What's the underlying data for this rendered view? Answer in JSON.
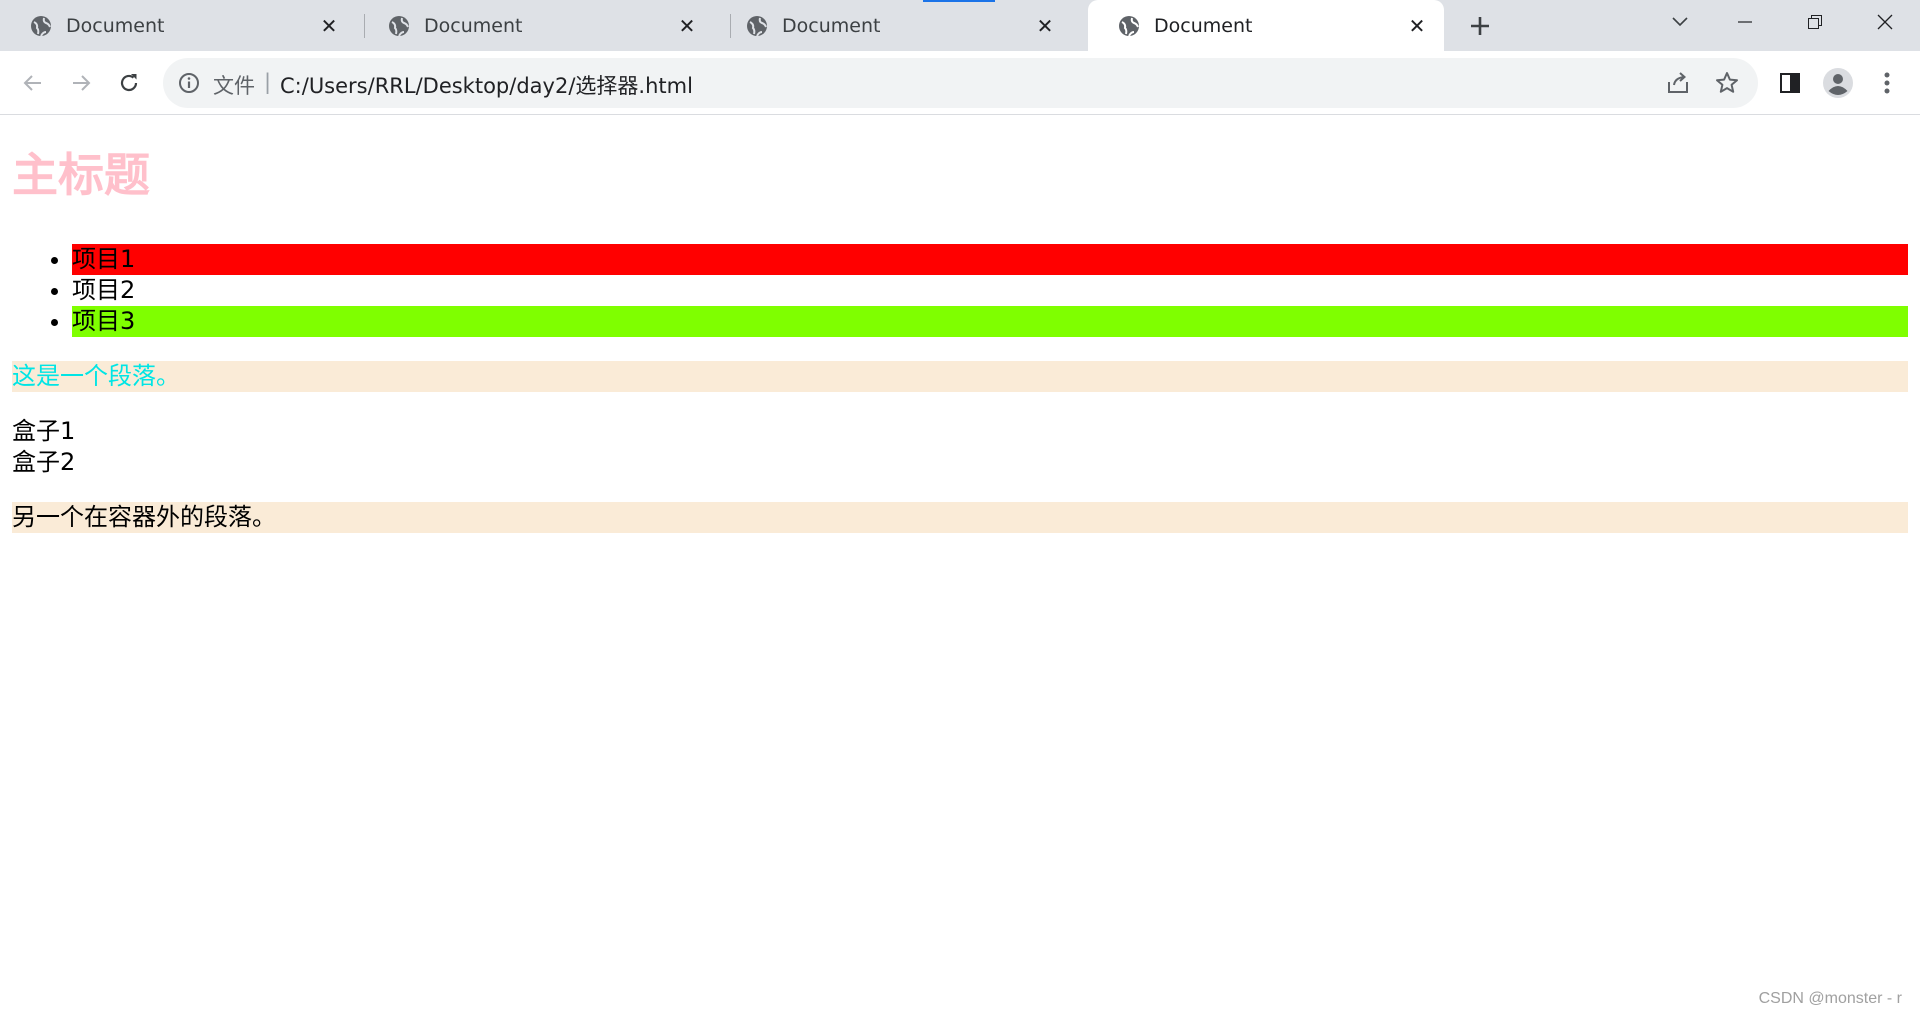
{
  "browser": {
    "tabs": [
      {
        "title": "Document",
        "active": false
      },
      {
        "title": "Document",
        "active": false
      },
      {
        "title": "Document",
        "active": false
      },
      {
        "title": "Document",
        "active": true
      }
    ],
    "address": {
      "scheme_label": "文件",
      "divider": "|",
      "url": "C:/Users/RRL/Desktop/day2/选择器.html"
    },
    "icons": {
      "tab_favicon": "globe-icon",
      "tab_close": "close-icon",
      "new_tab": "plus-icon",
      "back": "arrow-left-icon",
      "forward": "arrow-right-icon",
      "reload": "reload-icon",
      "site_info": "info-icon",
      "share": "share-icon",
      "bookmark": "star-icon",
      "side_panel": "side-panel-icon",
      "profile": "profile-icon",
      "menu": "more-vert-icon"
    }
  },
  "page": {
    "heading": "主标题",
    "list_items": [
      "项目1",
      "项目2",
      "项目3"
    ],
    "paragraph_1": "这是一个段落。",
    "box_1": "盒子1",
    "box_2": "盒子2",
    "paragraph_2": "另一个在容器外的段落。"
  },
  "colors": {
    "heading": "#ffc0cb",
    "item_1_bg": "#ff0000",
    "item_3_bg": "#7fff00",
    "paragraph_bg": "#faebd7",
    "paragraph_1_text": "#00e5e5"
  },
  "watermark": "CSDN @monster - r"
}
